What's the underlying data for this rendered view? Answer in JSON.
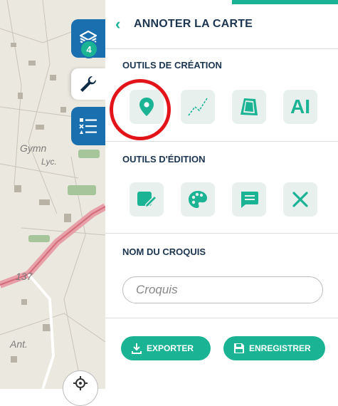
{
  "map": {
    "labels": [
      "Gymn",
      "Lyc.",
      "137",
      "Ant."
    ]
  },
  "toolbar": {
    "layers_badge": "4"
  },
  "panel": {
    "title": "ANNOTER LA CARTE",
    "creation_section": "OUTILS DE CRÉATION",
    "editing_section": "OUTILS D'ÉDITION",
    "name_section": "NOM DU CROQUIS",
    "name_placeholder": "Croquis",
    "text_tool_glyph": "AI",
    "export_label": "EXPORTER",
    "save_label": "ENREGISTRER"
  },
  "colors": {
    "accent": "#1ab394",
    "toolbar_blue": "#1a6fae",
    "title_navy": "#1c3550",
    "highlight_red": "#e2141a"
  }
}
